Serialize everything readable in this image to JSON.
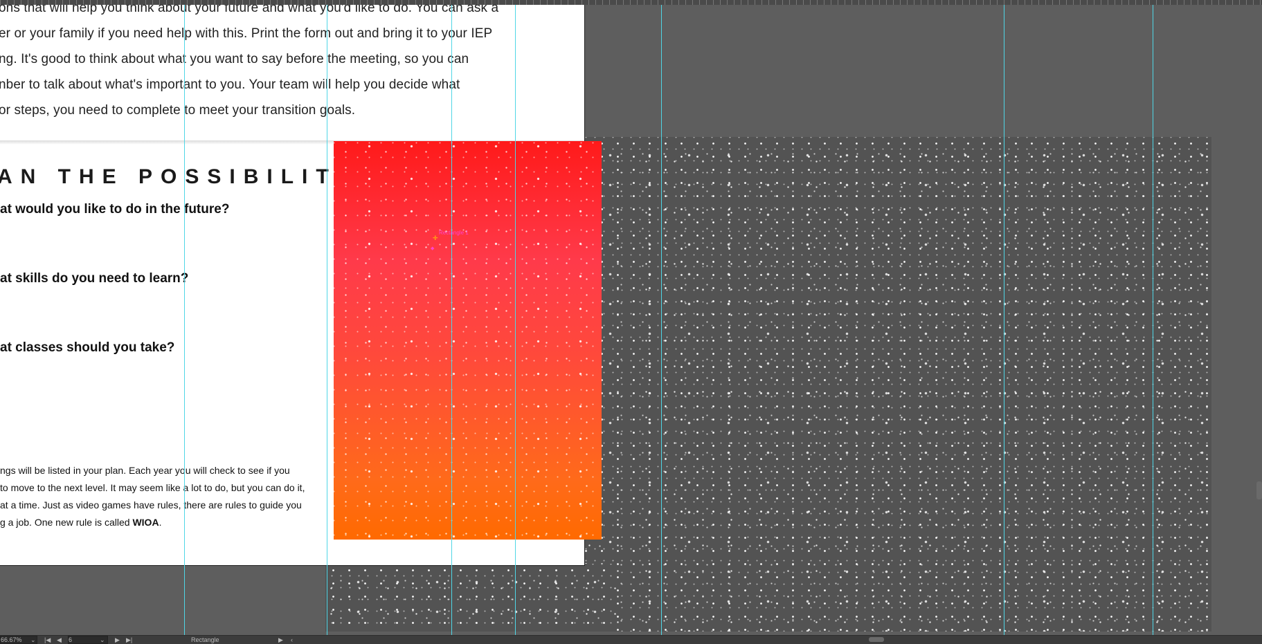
{
  "document": {
    "intro_lines": [
      "ons that will help you think about your future and what you'd like to do. You can ask a",
      "er or your family if you need help with this. Print the form out and bring it to your IEP",
      "ng. It's good to think about what you want to say before the meeting, so you can",
      "nber to talk about what's important to you. Your team will help you decide what",
      "or steps, you need to complete to meet your transition goals."
    ],
    "heading": "AN THE POSSIBILITY",
    "questions": [
      "at would you like to do in the future?",
      "at skills do you need to learn?",
      "at classes should you take?"
    ],
    "body_lines": [
      "ngs will be listed in your plan.  Each year you will check to see if you",
      " to move to the next level. It may seem like a lot to do, but you can do it,",
      "at a time. Just as video games have rules, there are rules to guide you",
      "g a job. One new rule is called "
    ],
    "body_bold": "WIOA",
    "body_end": "."
  },
  "canvas": {
    "cursor_label": "Rectangle 1",
    "accent_color": "#4fd6e6",
    "gradient_colors": [
      "#ff1a1a",
      "#ff6a00"
    ]
  },
  "statusbar": {
    "zoom": "66.67%",
    "page_number": "6",
    "tool_label": "Rectangle",
    "nav_first": "|◀",
    "nav_prev": "◀",
    "nav_next": "▶",
    "nav_last": "▶|",
    "play": "▶",
    "back": "‹"
  }
}
